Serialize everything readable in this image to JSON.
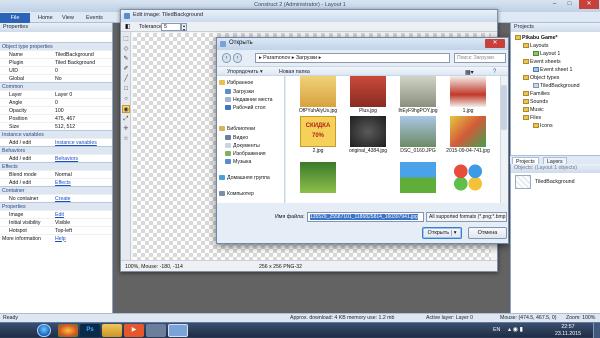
{
  "app": {
    "title": "Construct 2 (Administrator) - Layout 1"
  },
  "tabs": {
    "file": "File",
    "home": "Home",
    "view": "View",
    "events": "Events"
  },
  "properties": {
    "title": "Properties",
    "object_type_section": "Object type properties",
    "plugin_name_k": "Name",
    "plugin_name_v": "TiledBackground",
    "plugin_k": "Plugin",
    "plugin_v": "Tiled Background",
    "uid_k": "UID",
    "uid_v": "0",
    "global_k": "Global",
    "global_v": "No",
    "common_section": "Common",
    "layer_k": "Layer",
    "layer_v": "Layer 0",
    "angle_k": "Angle",
    "angle_v": "0",
    "opacity_k": "Opacity",
    "opacity_v": "100",
    "position_k": "Position",
    "position_v": "475, 467",
    "size_k": "Size",
    "size_v": "512, 512",
    "instvars_section": "Instance variables",
    "addedit1_k": "Add / edit",
    "addedit1_v": "Instance variables",
    "behaviors_section": "Behaviors",
    "addedit2_k": "Add / edit",
    "addedit2_v": "Behaviors",
    "effects_section": "Effects",
    "blend_k": "Blend mode",
    "blend_v": "Normal",
    "addedit3_k": "Add / edit",
    "addedit3_v": "Effects",
    "container_section": "Container",
    "nocontainer_k": "No container",
    "nocontainer_v": "Create",
    "properties_section": "Properties",
    "image_k": "Image",
    "image_v": "Edit",
    "initvis_k": "Initial visibility",
    "initvis_v": "Visible",
    "hotspot_k": "Hotspot",
    "hotspot_v": "Top-left",
    "moreinfo_k": "More information",
    "moreinfo_v": "Help"
  },
  "image_editor": {
    "title": "Edit image: TiledBackground",
    "tolerance_label": "Tolerance:",
    "tolerance_value": "5",
    "status_zoom": "100%, Mouse: -180, -114",
    "status_size": "256 x 256  PNG-32"
  },
  "open_dialog": {
    "title": "Открыть",
    "address": "▸ Paramonov ▸ Загрузки ▸",
    "search_placeholder": "Поиск: Загрузки",
    "organize": "Упорядочить ▾",
    "new_folder": "Новая папка",
    "nav": {
      "favorites": "Избранное",
      "downloads": "Загрузки",
      "recent": "Недавние места",
      "desktop": "Рабочий стол",
      "libraries": "Библиотеки",
      "video": "Видео",
      "documents": "Документы",
      "images": "Изображения",
      "music": "Музыка",
      "homegroup": "Домашняя группа",
      "computer": "Компьютер"
    },
    "files": [
      {
        "name": "OfPYuhAlyUs.jpg"
      },
      {
        "name": "Plus.jpg"
      },
      {
        "name": "lhEyF9hgPOY.jpg"
      },
      {
        "name": "1.jpg"
      },
      {
        "name": "2.jpg"
      },
      {
        "name": "original_4384.jpg"
      },
      {
        "name": "DSC_0160.JPG"
      },
      {
        "name": "2015-09-04-741.jpg"
      },
      {
        "name": ""
      },
      {
        "name": ""
      },
      {
        "name": ""
      },
      {
        "name": ""
      }
    ],
    "filename_label": "Имя файла:",
    "filename_value": "135529_25587101_1186825814_160397941.jpg",
    "filetype": "All supported formats (*.png;*.bmp;*.jpg)",
    "open_label": "Открыть",
    "cancel_label": "Отмена",
    "sale_text": "СКИДКА 70%"
  },
  "projects": {
    "title": "Projects",
    "root": "Pikabu Game*",
    "layouts": "Layouts",
    "layout1": "Layout 1",
    "event_sheets": "Event sheets",
    "event_sheet1": "Event sheet 1",
    "object_types": "Object types",
    "tiled_bg": "TiledBackground",
    "families": "Families",
    "sounds": "Sounds",
    "music": "Music",
    "files": "Files",
    "icons": "Icons"
  },
  "panel_tabs": {
    "projects": "Projects",
    "layers": "Layers"
  },
  "objects": {
    "title": "Objects: (Layout 1 objects)",
    "item": "TiledBackground"
  },
  "statusbar": {
    "ready": "Ready",
    "download": "Approx. download: 4 KB  memory use: 1.2 mb",
    "layer": "Active layer: Layer 0",
    "mouse": "Mouse: (474.5, 467.5, 0)",
    "zoom": "Zoom: 100%"
  },
  "taskbar": {
    "lang": "EN",
    "time": "22:57",
    "date": "23.11.2015"
  }
}
